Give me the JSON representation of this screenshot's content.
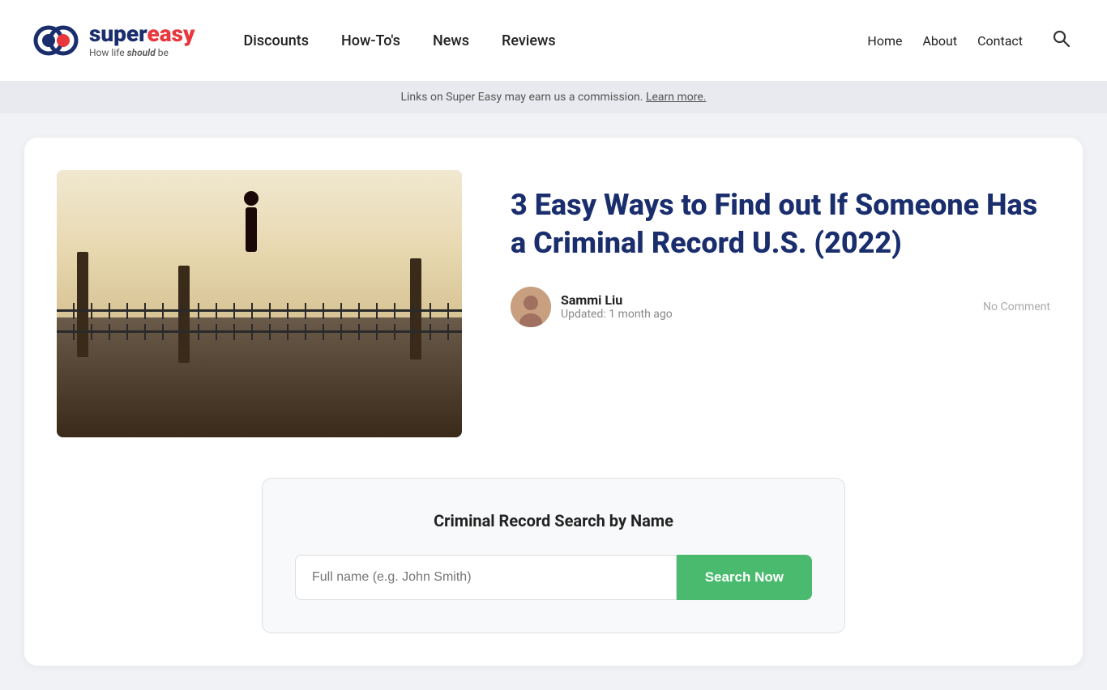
{
  "header": {
    "logo": {
      "brand_super": "super",
      "brand_easy": "easy",
      "tagline_prefix": "How life ",
      "tagline_italic": "should",
      "tagline_suffix": " be"
    },
    "nav_main": [
      {
        "label": "Discounts",
        "href": "#"
      },
      {
        "label": "How-To's",
        "href": "#"
      },
      {
        "label": "News",
        "href": "#"
      },
      {
        "label": "Reviews",
        "href": "#"
      }
    ],
    "nav_secondary": [
      {
        "label": "Home",
        "href": "#"
      },
      {
        "label": "About",
        "href": "#"
      },
      {
        "label": "Contact",
        "href": "#"
      }
    ]
  },
  "commission_banner": {
    "text": "Links on Super Easy may earn us a commission.",
    "link_text": "Learn more."
  },
  "article": {
    "title": "3 Easy Ways to Find out If Someone Has a Criminal Record U.S. (2022)",
    "author_name": "Sammi Liu",
    "updated_text": "Updated: 1 month ago",
    "no_comment_text": "No Comment"
  },
  "search_widget": {
    "title": "Criminal Record Search by Name",
    "input_placeholder": "Full name (e.g. John Smith)",
    "button_label": "Search Now"
  }
}
